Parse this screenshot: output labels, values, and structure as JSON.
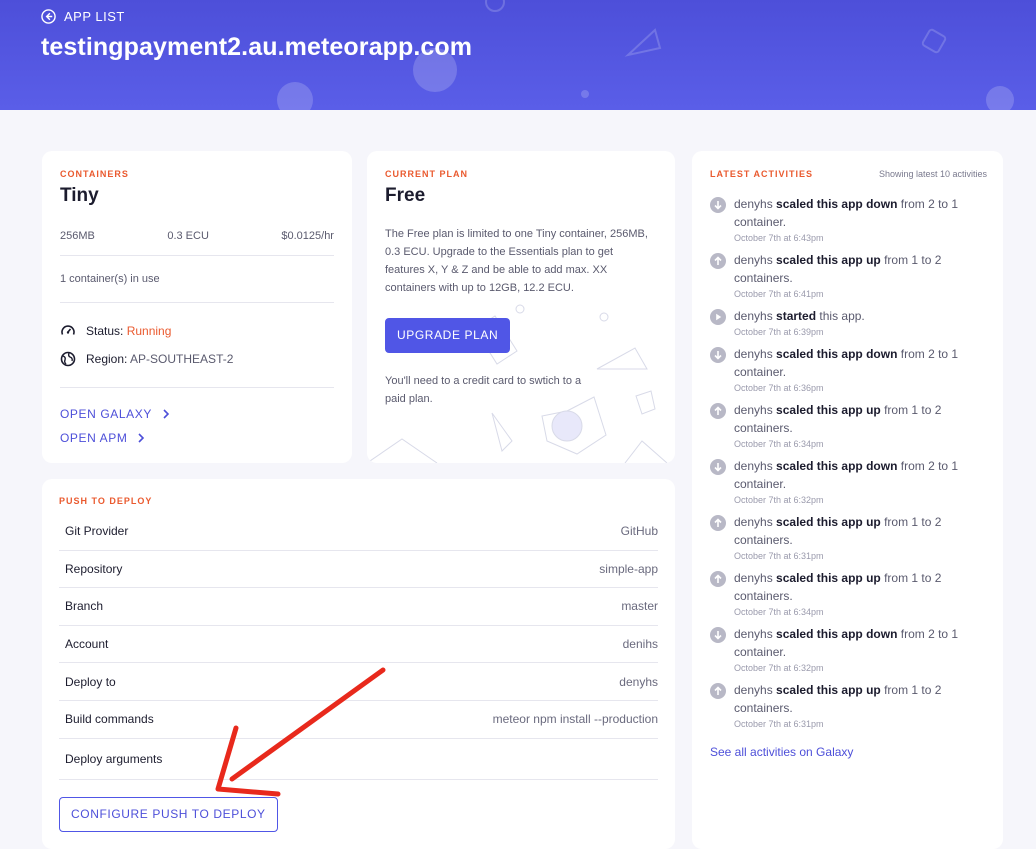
{
  "header": {
    "back_label": "APP LIST",
    "app_title": "testingpayment2.au.meteorapp.com"
  },
  "containers": {
    "section_label": "CONTAINERS",
    "size_name": "Tiny",
    "memory": "256MB",
    "ecu": "0.3 ECU",
    "price": "$0.0125/hr",
    "in_use": "1 container(s) in use",
    "status_label": "Status:",
    "status_value": "Running",
    "region_label": "Region:",
    "region_value": "AP-SOUTHEAST-2",
    "open_galaxy": "OPEN GALAXY",
    "open_apm": "OPEN APM"
  },
  "plan": {
    "section_label": "CURRENT PLAN",
    "name": "Free",
    "description": "The Free plan is limited to one Tiny container, 256MB, 0.3 ECU. Upgrade to the Essentials plan to get features X, Y & Z and be able to add max. XX containers with up to 12GB, 12.2 ECU.",
    "upgrade_button": "UPGRADE PLAN",
    "note": "You'll need to a credit card to swtich to a paid plan."
  },
  "deploy": {
    "section_label": "PUSH TO DEPLOY",
    "rows": [
      {
        "key": "Git Provider",
        "value": "GitHub"
      },
      {
        "key": "Repository",
        "value": "simple-app"
      },
      {
        "key": "Branch",
        "value": "master"
      },
      {
        "key": "Account",
        "value": "denihs"
      },
      {
        "key": "Deploy to",
        "value": "denyhs"
      },
      {
        "key": "Build commands",
        "value": "meteor npm install --production"
      },
      {
        "key": "Deploy arguments",
        "value": ""
      }
    ],
    "configure_button": "CONFIGURE PUSH TO DEPLOY"
  },
  "activities": {
    "section_label": "LATEST ACTIVITIES",
    "count_label": "Showing latest 10 activities",
    "items": [
      {
        "icon": "arrow-down-circle-icon",
        "user": "denyhs",
        "action": "scaled this app down",
        "rest": " from 2 to 1 container.",
        "time": "October 7th at 6:43pm"
      },
      {
        "icon": "arrow-up-circle-icon",
        "user": "denyhs",
        "action": "scaled this app up",
        "rest": " from 1 to 2 containers.",
        "time": "October 7th at 6:41pm"
      },
      {
        "icon": "play-circle-icon",
        "user": "denyhs",
        "action": "started",
        "rest": " this app.",
        "time": "October 7th at 6:39pm"
      },
      {
        "icon": "arrow-down-circle-icon",
        "user": "denyhs",
        "action": "scaled this app down",
        "rest": " from 2 to 1 container.",
        "time": "October 7th at 6:36pm"
      },
      {
        "icon": "arrow-up-circle-icon",
        "user": "denyhs",
        "action": "scaled this app up",
        "rest": " from 1 to 2 containers.",
        "time": "October 7th at 6:34pm"
      },
      {
        "icon": "arrow-down-circle-icon",
        "user": "denyhs",
        "action": "scaled this app down",
        "rest": " from 2 to 1 container.",
        "time": "October 7th at 6:32pm"
      },
      {
        "icon": "arrow-up-circle-icon",
        "user": "denyhs",
        "action": "scaled this app up",
        "rest": " from 1 to 2 containers.",
        "time": "October 7th at 6:31pm"
      },
      {
        "icon": "arrow-up-circle-icon",
        "user": "denyhs",
        "action": "scaled this app up",
        "rest": " from 1 to 2 containers.",
        "time": "October 7th at 6:34pm"
      },
      {
        "icon": "arrow-down-circle-icon",
        "user": "denyhs",
        "action": "scaled this app down",
        "rest": " from 2 to 1 container.",
        "time": "October 7th at 6:32pm"
      },
      {
        "icon": "arrow-up-circle-icon",
        "user": "denyhs",
        "action": "scaled this app up",
        "rest": " from 1 to 2 containers.",
        "time": "October 7th at 6:31pm"
      }
    ],
    "see_all": "See all activities on Galaxy"
  },
  "colors": {
    "header": "#4d4fd9",
    "accent": "#5056e6",
    "section_label": "#ea5a2f",
    "annotation_arrow": "#e8291c"
  }
}
